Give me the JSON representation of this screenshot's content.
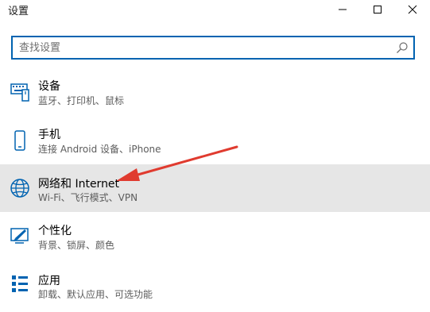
{
  "window": {
    "title": "设置"
  },
  "search": {
    "placeholder": "查找设置"
  },
  "items": [
    {
      "label": "设备",
      "desc": "蓝牙、打印机、鼠标",
      "icon": "devices-icon"
    },
    {
      "label": "手机",
      "desc": "连接 Android 设备、iPhone",
      "icon": "phone-icon"
    },
    {
      "label": "网络和 Internet",
      "desc": "Wi-Fi、飞行模式、VPN",
      "icon": "globe-icon"
    },
    {
      "label": "个性化",
      "desc": "背景、锁屏、颜色",
      "icon": "personalization-icon"
    },
    {
      "label": "应用",
      "desc": "卸载、默认应用、可选功能",
      "icon": "apps-icon"
    }
  ],
  "colors": {
    "accent": "#0063b1",
    "annotation": "#e03b2f",
    "selected_bg": "#e6e6e6"
  }
}
